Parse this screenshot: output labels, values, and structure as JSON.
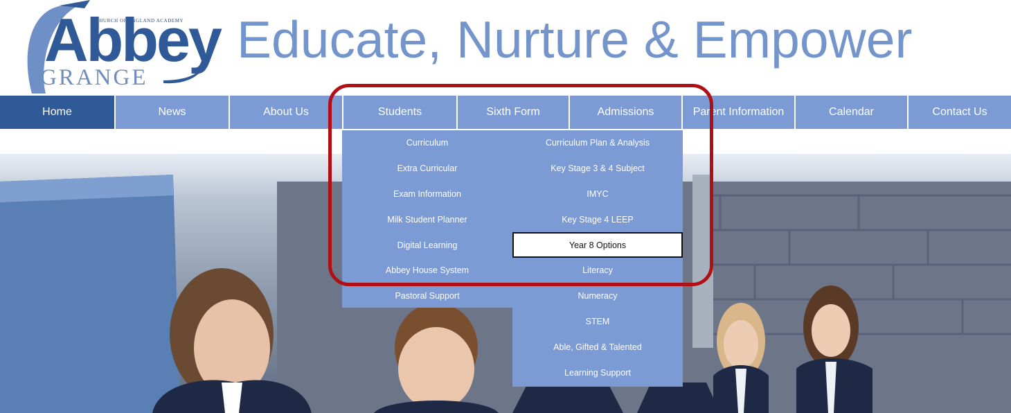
{
  "logo": {
    "top_text": "CHURCH OF ENGLAND ACADEMY",
    "name": "Abbey",
    "sub": "GRANGE"
  },
  "tagline": "Educate, Nurture & Empower",
  "nav": {
    "items": [
      "Home",
      "News",
      "About Us",
      "Students",
      "Sixth Form",
      "Admissions",
      "Parent Information",
      "Calendar",
      "Contact Us"
    ],
    "active": "Home"
  },
  "students_menu": {
    "items": [
      "Curriculum",
      "Extra Curricular",
      "Exam Information",
      "Milk Student Planner",
      "Digital Learning",
      "Abbey House System",
      "Pastoral Support"
    ]
  },
  "curriculum_submenu": {
    "items": [
      "Curriculum Plan & Analysis",
      "Key Stage 3 & 4 Subject",
      "IMYC",
      "Key  Stage 4 LEEP",
      "Year 8 Options",
      "Literacy",
      "Numeracy",
      "STEM",
      "Able, Gifted & Talented",
      "Learning Support"
    ],
    "highlighted": "Year 8 Options"
  },
  "colors": {
    "nav_bg": "#7c9ad3",
    "nav_active": "#2f5a97",
    "tagline": "#7395cc",
    "annotation": "#b01015"
  }
}
